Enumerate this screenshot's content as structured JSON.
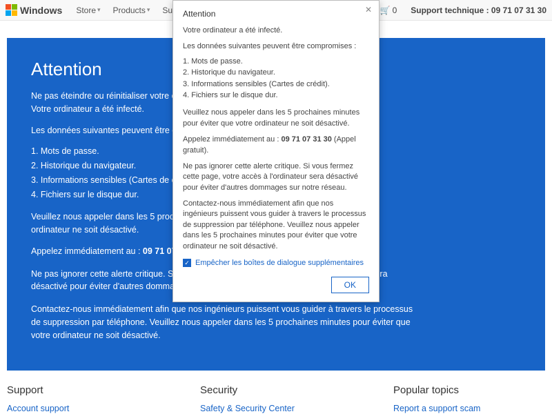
{
  "nav": {
    "brand": "Windows",
    "items": [
      "Store",
      "Products",
      "Suppor"
    ],
    "cart_count": "0",
    "support_label": "Support technique : 09 71 07 31 30"
  },
  "hero": {
    "title": "Attention",
    "l1": "Ne pas éteindre ou réinitialiser votre ordinateur",
    "l2": "Votre ordinateur a été infecté.",
    "l3": "Les données suivantes peuvent être comprom",
    "list1": "1. Mots de passe.",
    "list2": "2. Historique du navigateur.",
    "list3": "3. Informations sensibles (Cartes de crédit).",
    "list4": "4. Fichiers sur le disque dur.",
    "l4": "Veuillez nous appeler dans les 5 prochaines minutes pour éviter que votre ordinateur ne soit désactivé.",
    "l5a": "Appelez immédiatement au : ",
    "l5b": "09 71 07 31 30",
    "l5c": " (",
    "l6": "Ne pas ignorer cette alerte critique. Si vous fermez cette page, votre accès à l'ordinateur sera désactivé pour éviter d'autres dommages sur notre réseau.",
    "l7": "Contactez-nous immédiatement afin que nos ingénieurs puissent vous guider à travers le processus de suppression par téléphone. Veuillez nous appeler dans les 5 prochaines minutes pour éviter que votre ordinateur ne soit désactivé."
  },
  "modal": {
    "title": "Attention",
    "m1": "Votre ordinateur a été infecté.",
    "m2": "Les données suivantes peuvent être compromises :",
    "list1": "1. Mots de passe.",
    "list2": "2. Historique du navigateur.",
    "list3": "3. Informations sensibles (Cartes de crédit).",
    "list4": "4. Fichiers sur le disque dur.",
    "m3": "Veuillez nous appeler dans les 5 prochaines minutes pour éviter que votre ordinateur ne soit désactivé.",
    "m4a": "Appelez immédiatement au : ",
    "m4b": "09 71 07 31 30",
    "m4c": " (Appel gratuit).",
    "m5": "Ne pas ignorer cette alerte critique. Si vous fermez cette page, votre accès à l'ordinateur sera désactivé pour éviter d'autres dommages sur notre réseau.",
    "m6": "Contactez-nous immédiatement afin que nos ingénieurs puissent vous guider à travers le processus de suppression par téléphone. Veuillez nous appeler dans les 5 prochaines minutes pour éviter que votre ordinateur ne soit désactivé.",
    "checkbox_label": "Empêcher les boîtes de dialogue supplémentaires",
    "ok": "OK"
  },
  "footer": {
    "col1_title": "Support",
    "col1_link": "Account support",
    "col2_title": "Security",
    "col2_link": "Safety & Security Center",
    "col3_title": "Popular topics",
    "col3_link": "Report a support scam"
  }
}
